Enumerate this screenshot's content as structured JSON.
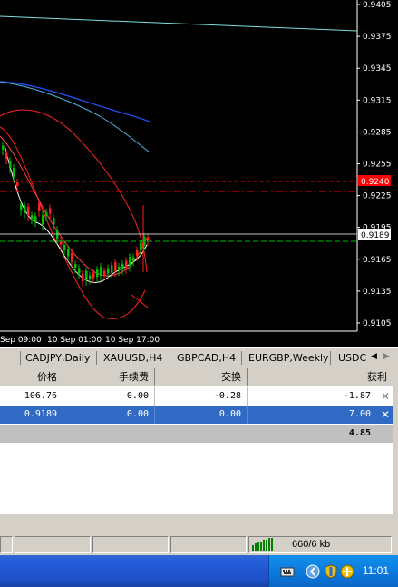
{
  "chart": {
    "price_labels": [
      "0.9405",
      "0.9375",
      "0.9345",
      "0.9315",
      "0.9285",
      "0.9255",
      "0.9225",
      "0.9195",
      "0.9165",
      "0.9135",
      "0.9105"
    ],
    "marked_levels": [
      {
        "label": "0.9240",
        "color": "#ff0000"
      },
      {
        "label": "0.9189",
        "color": "#ffffff"
      }
    ],
    "time_labels": [
      "Sep 09:00",
      "10 Sep 01:00",
      "10 Sep 17:00"
    ]
  },
  "tabs": {
    "items": [
      "CADJPY,Daily",
      "XAUUSD,H4",
      "GBPCAD,H4",
      "EURGBP,Weekly",
      "USDC"
    ],
    "scroll_left": "◀",
    "scroll_right": "▶"
  },
  "table": {
    "headers": [
      "价格",
      "手续费",
      "交换",
      "获利"
    ],
    "rows": [
      {
        "price": "106.76",
        "commission": "0.00",
        "swap": "-0.28",
        "profit": "-1.87",
        "close": "✕"
      },
      {
        "price": "0.9189",
        "commission": "0.00",
        "swap": "0.00",
        "profit": "7.00",
        "close": "✕"
      }
    ],
    "total": "4.85"
  },
  "status": {
    "traffic": "660/6 kb"
  },
  "taskbar": {
    "clock": "11:01"
  },
  "colors": {
    "chart_bg": "#000000",
    "selected_row": "#316ac5",
    "red_level": "#ff0000",
    "green_level": "#00c000"
  }
}
